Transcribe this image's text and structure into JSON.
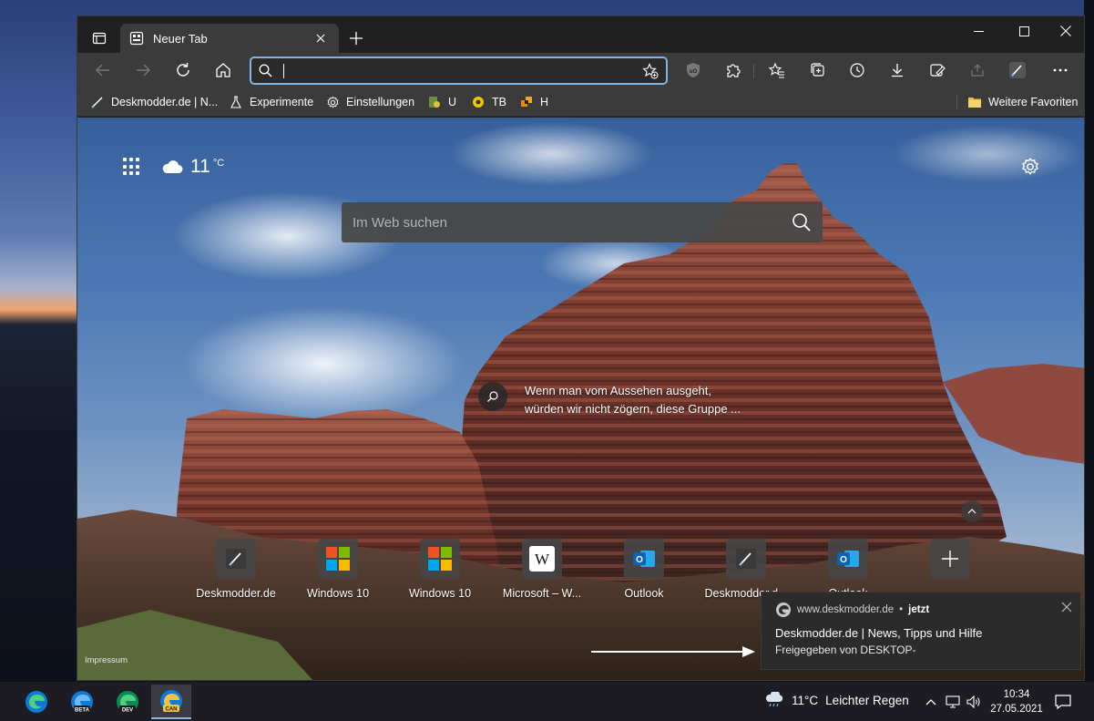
{
  "window": {
    "tab_title": "Neuer Tab"
  },
  "toolbar": {
    "address_value": ""
  },
  "favorites": {
    "items": [
      {
        "label": "Deskmodder.de | N...",
        "icon": "brush-icon"
      },
      {
        "label": "Experimente",
        "icon": "flask-icon"
      },
      {
        "label": "Einstellungen",
        "icon": "gear-icon"
      },
      {
        "label": "U",
        "icon": "u-favicon"
      },
      {
        "label": "TB",
        "icon": "tb-favicon"
      },
      {
        "label": "H",
        "icon": "h-favicon"
      }
    ],
    "other_label": "Weitere Favoriten"
  },
  "ntp": {
    "weather_temp": "11",
    "weather_unit": "°C",
    "search_placeholder": "Im Web suchen",
    "caption_line1": "Wenn man vom Aussehen ausgeht,",
    "caption_line2": "würden wir nicht zögern, diese Gruppe ...",
    "impressum": "Impressum",
    "tiles": [
      {
        "label": "Deskmodder.de",
        "icon": "brush-icon"
      },
      {
        "label": "Windows 10",
        "icon": "windows-icon"
      },
      {
        "label": "Windows 10",
        "icon": "windows-icon"
      },
      {
        "label": "Microsoft – W...",
        "icon": "wikipedia-icon"
      },
      {
        "label": "Outlook",
        "icon": "outlook-icon"
      },
      {
        "label": "Deskmodder.d...",
        "icon": "brush-icon"
      },
      {
        "label": "Outlook",
        "icon": "outlook-icon"
      },
      {
        "label": "",
        "icon": "plus-icon"
      }
    ]
  },
  "toast": {
    "source": "www.deskmodder.de",
    "time": "jetzt",
    "title": "Deskmodder.de | News, Tipps und Hilfe",
    "subtitle": "Freigegeben von DESKTOP-"
  },
  "taskbar": {
    "apps": [
      {
        "icon": "edge-icon",
        "badge": ""
      },
      {
        "icon": "edge-beta-icon",
        "badge": "BETA"
      },
      {
        "icon": "edge-dev-icon",
        "badge": "DEV"
      },
      {
        "icon": "edge-canary-icon",
        "badge": "CAN"
      }
    ],
    "weather": "11°C",
    "weather_desc": "Leichter Regen",
    "time": "10:34",
    "date": "27.05.2021"
  }
}
